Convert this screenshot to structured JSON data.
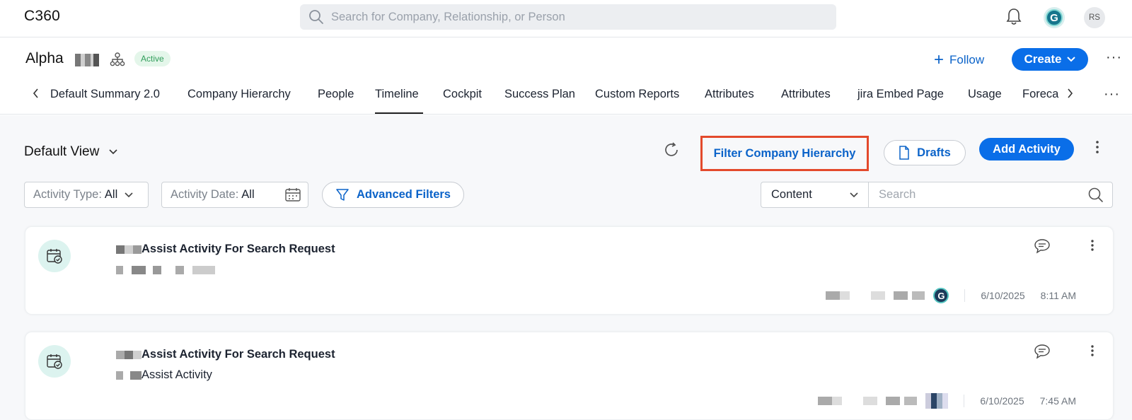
{
  "app": {
    "title": "C360"
  },
  "global_search": {
    "placeholder": "Search for Company, Relationship, or Person"
  },
  "user": {
    "initials": "RS",
    "brand_initial": "G"
  },
  "company": {
    "name": "Alpha",
    "status": "Active",
    "follow_label": "Follow",
    "create_label": "Create"
  },
  "tabs": [
    {
      "label": "Default Summary 2.0"
    },
    {
      "label": "Company Hierarchy"
    },
    {
      "label": "People"
    },
    {
      "label": "Timeline",
      "active": true
    },
    {
      "label": "Cockpit"
    },
    {
      "label": "Success Plan"
    },
    {
      "label": "Custom Reports"
    },
    {
      "label": "Attributes"
    },
    {
      "label": "Attributes"
    },
    {
      "label": "jira Embed Page"
    },
    {
      "label": "Usage"
    },
    {
      "label": "Foreca"
    }
  ],
  "timeline": {
    "view_label": "Default View",
    "filter_hierarchy_label": "Filter Company Hierarchy",
    "drafts_label": "Drafts",
    "add_activity_label": "Add Activity",
    "filters": {
      "activity_type_label": "Activity Type:",
      "activity_type_value": "All",
      "activity_date_label": "Activity Date:",
      "activity_date_value": "All",
      "advanced_label": "Advanced Filters",
      "content_select": "Content",
      "search_placeholder": "Search"
    },
    "activities": [
      {
        "title": "Assist Activity For Search Request",
        "subtitle": "",
        "date": "6/10/2025",
        "time": "8:11 AM"
      },
      {
        "title": "Assist Activity For Search Request",
        "subtitle": "Assist Activity",
        "date": "6/10/2025",
        "time": "7:45 AM"
      }
    ]
  },
  "colors": {
    "primary": "#0a6ee8",
    "link": "#0b63c9",
    "highlight_border": "#e34a2c",
    "active_badge_bg": "#e4f6ea",
    "active_badge_text": "#2f9d5a"
  },
  "icons": [
    "search-icon",
    "bell-icon",
    "hierarchy-icon",
    "plus-icon",
    "chevron-down-icon",
    "chevron-left-icon",
    "chevron-right-icon",
    "more-horizontal-icon",
    "refresh-icon",
    "document-icon",
    "more-vertical-icon",
    "calendar-icon",
    "filter-icon",
    "calendar-check-icon",
    "comment-icon"
  ]
}
